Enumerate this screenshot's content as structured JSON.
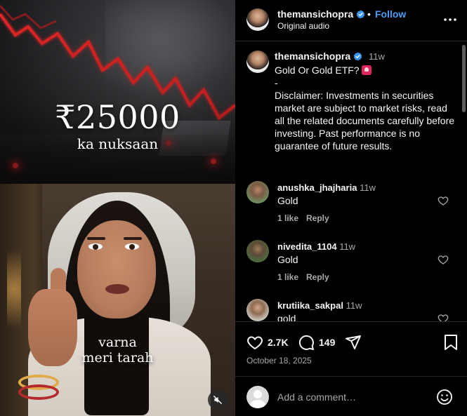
{
  "media": {
    "amount": "₹25000",
    "amount_caption": "ka nuksaan",
    "overlay_caption_line1": "varna",
    "overlay_caption_line2": "meri tarah",
    "mute_icon": "muted-speaker-icon"
  },
  "header": {
    "username": "themansichopra",
    "separator": "•",
    "follow_label": "Follow",
    "audio_label": "Original audio",
    "more_icon": "more-options-icon"
  },
  "caption": {
    "username": "themansichopra",
    "time_ago": "11w",
    "title": "Gold Or Gold ETF?",
    "body": "-\nDisclaimer: Investments in securities market are subject to market risks, read all the related documents carefully before investing. Past performance is no guarantee of future results."
  },
  "comments": [
    {
      "username": "anushka_jhajharia",
      "time_ago": "11w",
      "text": "Gold",
      "likes": "1 like",
      "reply": "Reply"
    },
    {
      "username": "nivedita_1104",
      "time_ago": "11w",
      "text": "Gold",
      "likes": "1 like",
      "reply": "Reply"
    },
    {
      "username": "krutiika_sakpal",
      "time_ago": "11w",
      "text": "gold",
      "likes": "",
      "reply": ""
    }
  ],
  "actions": {
    "like_count": "2.7K",
    "comment_count": "149",
    "post_date": "October 18, 2025"
  },
  "add_comment": {
    "placeholder": "Add a comment…"
  },
  "colors": {
    "accent": "#4a9df8",
    "verified": "#3897f0",
    "muted_text": "#a8a8a8",
    "text": "#f5f5f5",
    "trend_red": "#ff2a2a"
  }
}
